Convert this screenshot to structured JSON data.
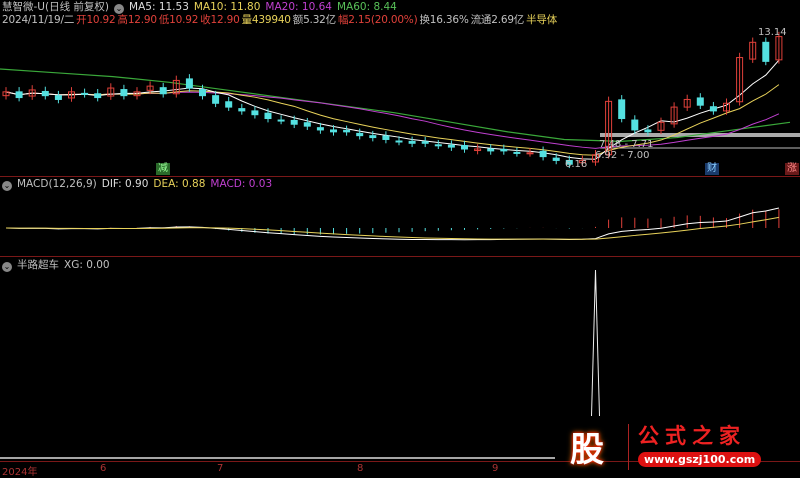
{
  "header": {
    "title": "慧智微-U(日线 前复权)",
    "ma5": "MA5: 11.53",
    "ma10": "MA10: 11.80",
    "ma20": "MA20: 10.64",
    "ma60": "MA60: 8.44"
  },
  "quote": {
    "date": "2024/11/19/二",
    "open": "开10.92",
    "high": "高12.90",
    "low": "低10.92",
    "close": "收12.90",
    "volume": "量439940",
    "amount": "额5.32亿",
    "change": "幅2.15(20.00%)",
    "turnover": "换16.36%",
    "float": "流通2.69亿",
    "concept": "半导体"
  },
  "annotations": {
    "high": "13.14",
    "low": "6.16",
    "range1": "7.48 - 7.71",
    "range2": "6.92 - 7.00",
    "tag_reduce": "减",
    "tag_finance": "财",
    "tag_rise": "涨"
  },
  "macd": {
    "title": "MACD(12,26,9)",
    "dif": "DIF: 0.90",
    "dea": "DEA: 0.88",
    "macd": "MACD: 0.03"
  },
  "indicator": {
    "title": "半路超车",
    "xg": "XG: 0.00"
  },
  "axis": {
    "labels": [
      "2024年",
      "6",
      "7",
      "8",
      "9"
    ]
  },
  "logo": {
    "char": "股",
    "name": "公式之家",
    "url": "www.gszj100.com"
  },
  "colors": {
    "up": "#e0413a",
    "down": "#54e0e0",
    "ma5": "#ffffff",
    "ma10": "#e8d25a",
    "ma20": "#c040d0",
    "ma60": "#3aa83a"
  },
  "chart_data": {
    "type": "candlestick",
    "closes": [
      10.0,
      9.7,
      10.1,
      9.8,
      9.6,
      10.0,
      9.9,
      9.7,
      10.2,
      9.8,
      10.0,
      10.3,
      9.9,
      10.6,
      10.2,
      9.8,
      9.4,
      9.2,
      9.0,
      8.8,
      8.6,
      8.5,
      8.3,
      8.2,
      8.0,
      7.9,
      7.9,
      7.7,
      7.6,
      7.5,
      7.4,
      7.3,
      7.3,
      7.2,
      7.1,
      7.0,
      7.0,
      6.9,
      6.9,
      6.8,
      6.8,
      6.6,
      6.4,
      6.2,
      6.4,
      6.7,
      9.5,
      8.6,
      8.0,
      7.9,
      8.4,
      9.2,
      9.6,
      9.3,
      9.0,
      9.4,
      11.8,
      12.6,
      11.6,
      12.9
    ],
    "ma60": [
      11.2,
      11.0,
      10.8,
      10.5,
      10.1,
      9.7,
      9.3,
      8.9,
      8.4,
      7.9,
      7.5,
      7.4,
      7.6,
      8.0,
      8.4
    ],
    "xg_signal_index": 45
  }
}
